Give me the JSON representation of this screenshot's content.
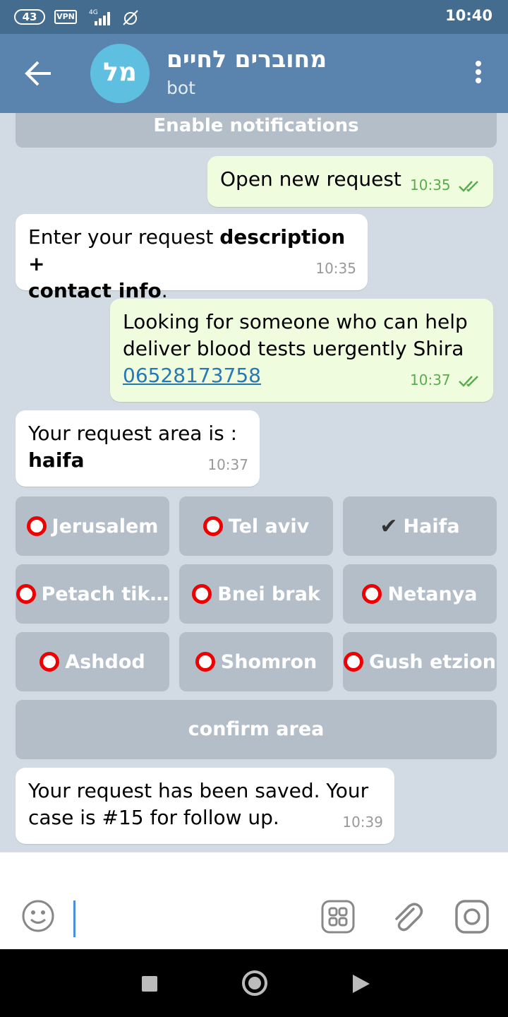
{
  "status_bar": {
    "battery": "43",
    "vpn": "VPN",
    "network": "4G",
    "time": "10:40"
  },
  "header": {
    "avatar_initials": "מל",
    "title": "מחוברים לחיים",
    "subtitle": "bot"
  },
  "chat": {
    "enable_notifications": "Enable notifications",
    "messages": [
      {
        "direction": "out",
        "text": "Open new request",
        "time": "10:35"
      },
      {
        "direction": "in",
        "text_plain1": "Enter your request ",
        "text_bold1": "description +",
        "text_bold2": "contact info",
        "text_plain2": ".",
        "time": "10:35"
      },
      {
        "direction": "out",
        "line1": "Looking for someone who can help",
        "line2": "deliver blood tests uergently Shira",
        "phone": "06528173758",
        "time": "10:37"
      },
      {
        "direction": "in",
        "line1": "Your request area is :",
        "line2": "haifa",
        "time": "10:37"
      },
      {
        "direction": "in",
        "line1": "Your request has been saved. Your",
        "line2": "case is #15 for follow up.",
        "time": "10:39"
      }
    ],
    "keyboard": [
      [
        "Jerusalem",
        "Tel aviv",
        "Haifa"
      ],
      [
        "Petach tik…",
        "Bnei brak",
        "Netanya"
      ],
      [
        "Ashdod",
        "Shomron",
        "Gush etzion"
      ]
    ],
    "selected_area": "Haifa",
    "confirm_label": "confirm area"
  },
  "colors": {
    "header": "#5a84ad",
    "status_bar": "#436c8f",
    "outgoing_bubble": "#effdde",
    "keyboard_button": "#b3bec8",
    "unselected_marker": "#ee0000"
  }
}
